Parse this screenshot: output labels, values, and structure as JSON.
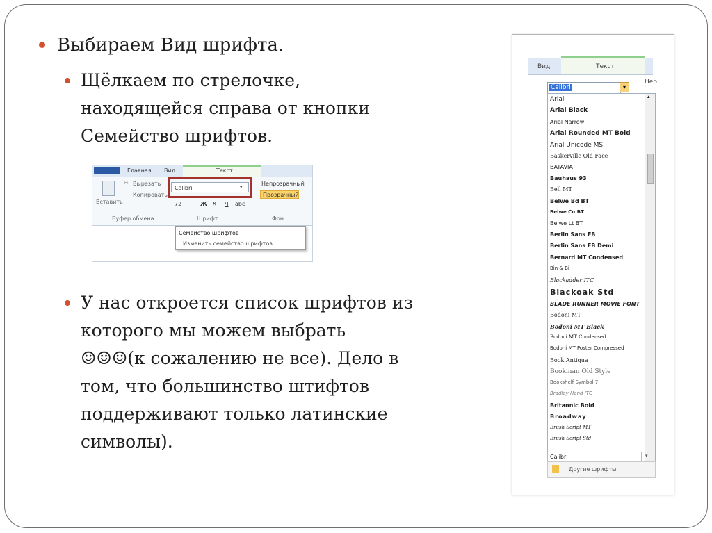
{
  "bullets": {
    "b1": "Выбираем Вид шрифта.",
    "b2_lines": [
      "Щёлкаем по стрелочке,",
      "находящейся справа от  кнопки",
      "Семейство шрифтов."
    ],
    "b3_lines": [
      "У нас откроется список шрифтов из",
      "которого мы можем выбрать",
      "☺☺☺(к сожалению не все). Дело в",
      "том, что большинство штифтов",
      "поддерживают только латинские",
      "символы)."
    ]
  },
  "ribbon": {
    "tabs": [
      "Главная",
      "Вид",
      "Текст"
    ],
    "cut": "Вырезать",
    "copy": "Копировать",
    "paste": "Вставить",
    "font_value": "Calibri",
    "size_value": "72",
    "format_buttons": [
      "Ж",
      "К",
      "Ч",
      "abc"
    ],
    "opaque": "Непрозрачный",
    "transparent": "Прозрачный",
    "groups": [
      "Буфер обмена",
      "Шрифт",
      "Фон"
    ],
    "tooltip_title": "Семейство шрифтов",
    "tooltip_text": "Изменить семейство шрифтов."
  },
  "fontlist": {
    "tabs": [
      "Вид",
      "Текст"
    ],
    "side_label": "Нер",
    "selected": "Calibri",
    "fonts": [
      "Arial",
      "Arial Black",
      "Arial Narrow",
      "Arial Rounded MT Bold",
      "Arial Unicode MS",
      "Baskerville Old Face",
      "BATAVIA",
      "Bauhaus 93",
      "Bell MT",
      "Belwe Bd BT",
      "Belwe Cn BT",
      "Belwe Lt BT",
      "Berlin Sans FB",
      "Berlin Sans FB Demi",
      "Bernard MT Condensed",
      "Bin & Bi",
      "Blackadder ITC",
      "Blackoak Std",
      "BLADE RUNNER MOVIE FONT",
      "Bodoni MT",
      "Bodoni MT Black",
      "Bodoni MT Condensed",
      "Bodoni MT Poster Compressed",
      "Book Antiqua",
      "Bookman Old Style",
      "Bookshelf Symbol 7",
      "Bradley Hand ITC",
      "Britannic Bold",
      "Broadway",
      "Brush Script MT",
      "Brush Script Std"
    ],
    "current": "Calibri",
    "more": "Другие шрифты"
  }
}
